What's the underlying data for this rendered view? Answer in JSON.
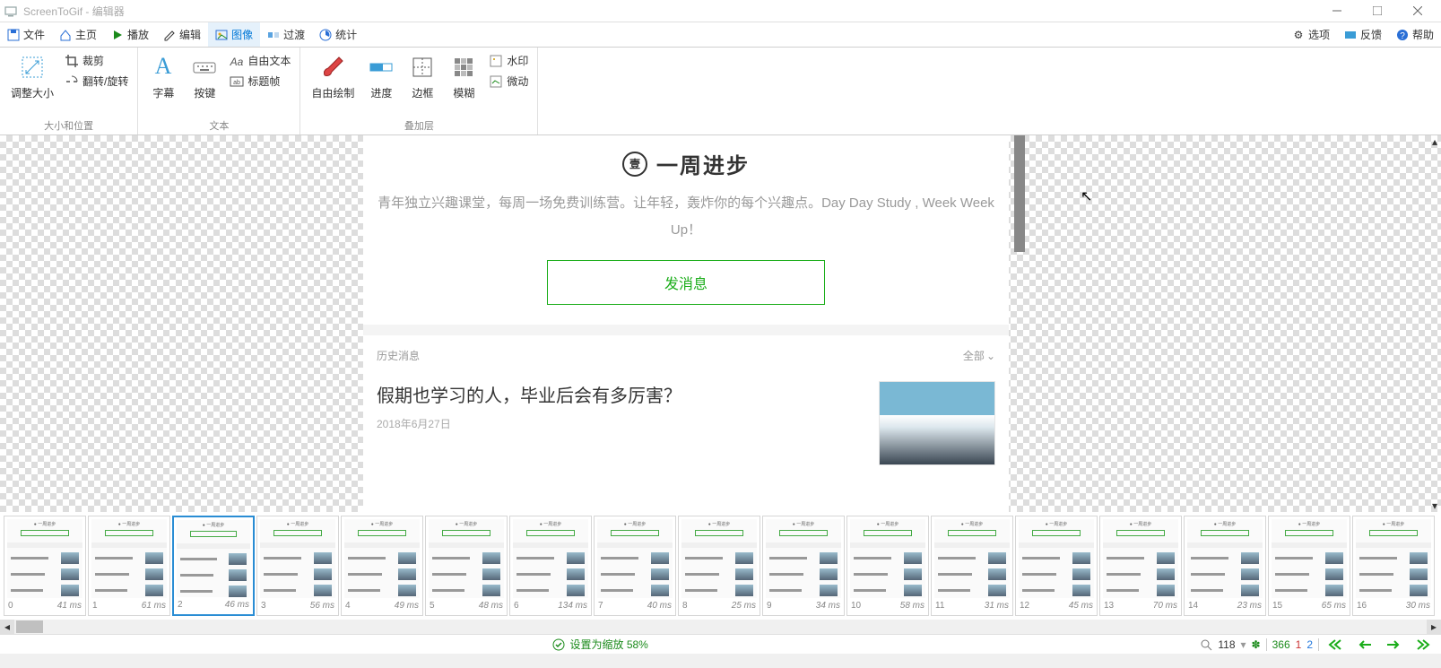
{
  "title": "ScreenToGif - 编辑器",
  "menu": {
    "file": "文件",
    "home": "主页",
    "play": "播放",
    "edit": "编辑",
    "image": "图像",
    "transition": "过渡",
    "stats": "统计"
  },
  "menuright": {
    "options": "选项",
    "feedback": "反馈",
    "help": "帮助"
  },
  "ribbon": {
    "group_size_pos": "大小和位置",
    "group_text": "文本",
    "group_overlay": "叠加层",
    "resize": "调整大小",
    "crop": "裁剪",
    "flip_rotate": "翻转/旋转",
    "caption": "字幕",
    "keystroke": "按键",
    "freetext": "自由文本",
    "titleframe": "标题帧",
    "drawing": "自由绘制",
    "progress": "进度",
    "border": "边框",
    "obfuscate": "模糊",
    "watermark": "水印",
    "cinemagraph": "微动"
  },
  "canvas": {
    "title": "一周进步",
    "desc": "青年独立兴趣课堂，每周一场免费训练营。让年轻，轰炸你的每个兴趣点。Day Day Study , Week Week Up！",
    "button": "发消息",
    "history": "历史消息",
    "all": "全部",
    "article_title": "假期也学习的人，毕业后会有多厉害？",
    "article_date": "2018年6月27日"
  },
  "frames": [
    {
      "n": "0",
      "ms": "41 ms"
    },
    {
      "n": "1",
      "ms": "61 ms"
    },
    {
      "n": "2",
      "ms": "46 ms"
    },
    {
      "n": "3",
      "ms": "56 ms"
    },
    {
      "n": "4",
      "ms": "49 ms"
    },
    {
      "n": "5",
      "ms": "48 ms"
    },
    {
      "n": "6",
      "ms": "134 ms"
    },
    {
      "n": "7",
      "ms": "40 ms"
    },
    {
      "n": "8",
      "ms": "25 ms"
    },
    {
      "n": "9",
      "ms": "34 ms"
    },
    {
      "n": "10",
      "ms": "58 ms"
    },
    {
      "n": "11",
      "ms": "31 ms"
    },
    {
      "n": "12",
      "ms": "45 ms"
    },
    {
      "n": "13",
      "ms": "70 ms"
    },
    {
      "n": "14",
      "ms": "23 ms"
    },
    {
      "n": "15",
      "ms": "65 ms"
    },
    {
      "n": "16",
      "ms": "30 ms"
    }
  ],
  "selected_frame": 2,
  "status": {
    "zoom_text": "设置为缩放 58%",
    "zoom_val": "118",
    "total": "366",
    "sel1": "1",
    "sel2": "2"
  }
}
